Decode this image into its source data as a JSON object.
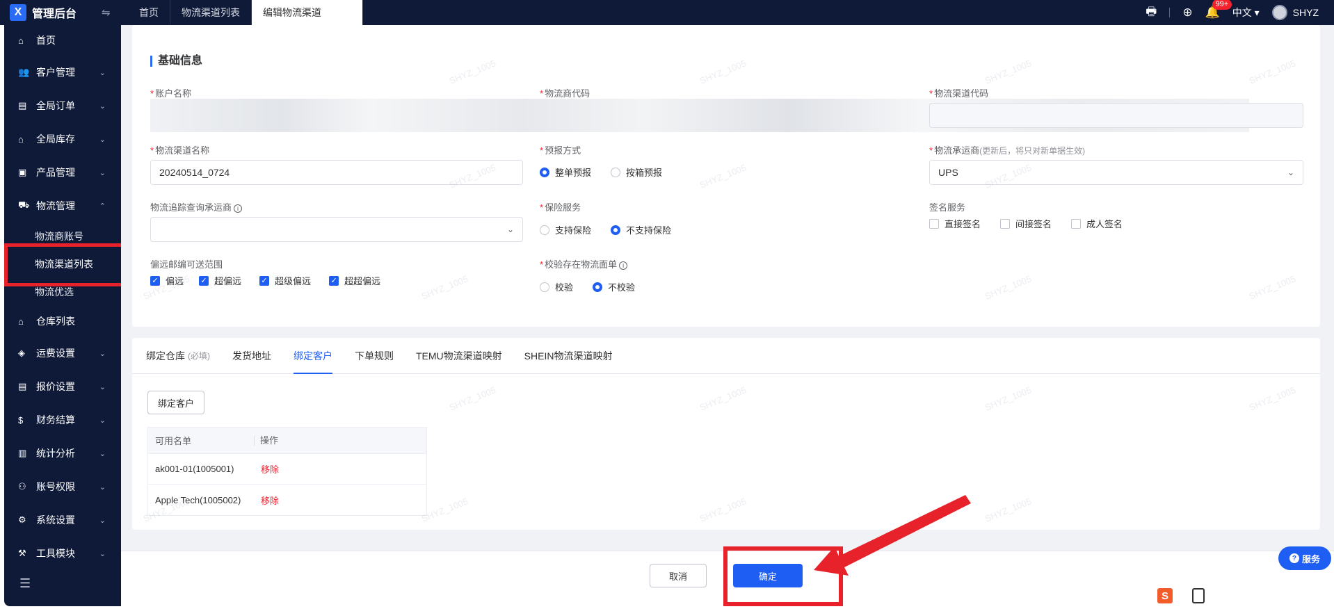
{
  "topbar": {
    "logo_mark": "X",
    "app_title": "管理后台",
    "tabs": [
      "首页",
      "物流渠道列表",
      "编辑物流渠道"
    ],
    "notification_count": "99+",
    "language": "中文 ▾",
    "username": "SHYZ"
  },
  "sidebar": {
    "items": [
      {
        "label": "首页",
        "icon": "home-icon"
      },
      {
        "label": "客户管理",
        "icon": "users-icon"
      },
      {
        "label": "全局订单",
        "icon": "order-icon"
      },
      {
        "label": "全局库存",
        "icon": "warehouse-icon"
      },
      {
        "label": "产品管理",
        "icon": "product-icon"
      },
      {
        "label": "物流管理",
        "icon": "truck-icon"
      },
      {
        "label": "仓库列表",
        "icon": "warehouse-list-icon"
      },
      {
        "label": "运费设置",
        "icon": "freight-icon"
      },
      {
        "label": "报价设置",
        "icon": "quote-icon"
      },
      {
        "label": "财务结算",
        "icon": "finance-icon"
      },
      {
        "label": "统计分析",
        "icon": "stats-icon"
      },
      {
        "label": "账号权限",
        "icon": "permission-icon"
      },
      {
        "label": "系统设置",
        "icon": "settings-icon"
      },
      {
        "label": "工具模块",
        "icon": "tools-icon"
      }
    ],
    "sub_items": [
      "物流商账号",
      "物流渠道列表",
      "物流优选"
    ]
  },
  "basic": {
    "section_title": "基础信息",
    "account_name_label": "账户名称",
    "carrier_code_label": "物流商代码",
    "channel_code_label": "物流渠道代码",
    "channel_name_label": "物流渠道名称",
    "channel_name_value": "20240514_0724",
    "prereport_label": "预报方式",
    "prereport_options": [
      "整单预报",
      "按箱预报"
    ],
    "carrier_label": "物流承运商",
    "carrier_hint": "(更新后，将只对新单据生效)",
    "carrier_value": "UPS",
    "tracking_label": "物流追踪查询承运商",
    "insurance_label": "保险服务",
    "insurance_options": [
      "支持保险",
      "不支持保险"
    ],
    "signature_label": "签名服务",
    "signature_options": [
      "直接签名",
      "间接签名",
      "成人签名"
    ],
    "remote_label": "偏远邮编可送范围",
    "remote_options": [
      "偏远",
      "超偏远",
      "超级偏远",
      "超超偏远"
    ],
    "verify_label": "校验存在物流面单",
    "verify_options": [
      "校验",
      "不校验"
    ]
  },
  "panel": {
    "tabs": [
      "绑定仓库",
      "发货地址",
      "绑定客户",
      "下单规则",
      "TEMU物流渠道映射",
      "SHEIN物流渠道映射"
    ],
    "tab_required_hint": "(必填)",
    "bind_button": "绑定客户",
    "table_headers": [
      "可用名单",
      "操作"
    ],
    "rows": [
      {
        "name": "ak001-01(1005001)",
        "action": "移除"
      },
      {
        "name": "Apple Tech(1005002)",
        "action": "移除"
      }
    ]
  },
  "footer": {
    "cancel": "取消",
    "confirm": "确定"
  },
  "service_label": "服务",
  "watermark_text": "SHYZ_1005",
  "colors": {
    "nav_bg": "#0e1a38",
    "primary": "#1e5ef3",
    "danger": "#f5222d",
    "annotation_red": "#e8222a"
  }
}
